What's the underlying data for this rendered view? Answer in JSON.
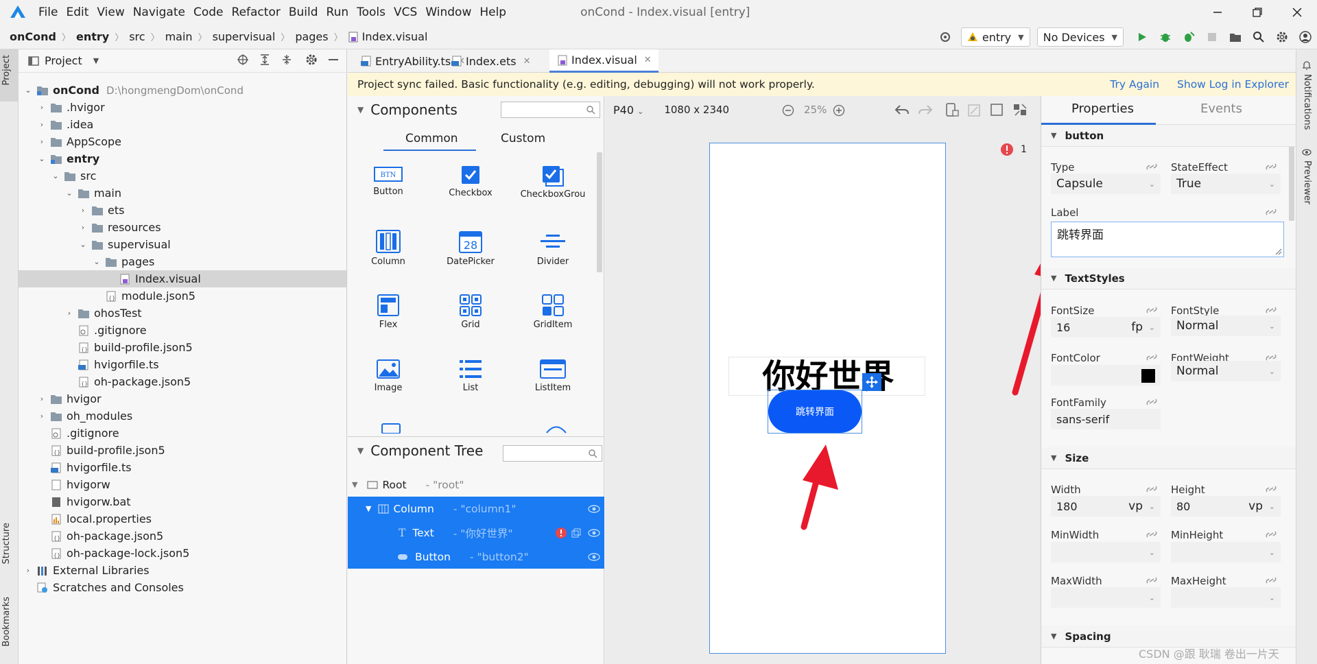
{
  "menubar": {
    "items": [
      "File",
      "Edit",
      "View",
      "Navigate",
      "Code",
      "Refactor",
      "Build",
      "Run",
      "Tools",
      "VCS",
      "Window",
      "Help"
    ],
    "window_title": "onCond - Index.visual [entry]"
  },
  "breadcrumb": [
    "onCond",
    "entry",
    "src",
    "main",
    "supervisual",
    "pages",
    "Index.visual"
  ],
  "toolbar": {
    "module_selector": "entry",
    "device_selector": "No Devices"
  },
  "project_panel": {
    "title": "Project",
    "tree": [
      {
        "label": "onCond",
        "hint": "D:\\hongmengDom\\onCond",
        "bold": true
      },
      {
        "label": ".hvigor"
      },
      {
        "label": ".idea"
      },
      {
        "label": "AppScope"
      },
      {
        "label": "entry",
        "bold": true
      },
      {
        "label": "src"
      },
      {
        "label": "main"
      },
      {
        "label": "ets"
      },
      {
        "label": "resources"
      },
      {
        "label": "supervisual"
      },
      {
        "label": "pages"
      },
      {
        "label": "Index.visual"
      },
      {
        "label": "module.json5"
      },
      {
        "label": "ohosTest"
      },
      {
        "label": ".gitignore"
      },
      {
        "label": "build-profile.json5"
      },
      {
        "label": "hvigorfile.ts"
      },
      {
        "label": "oh-package.json5"
      },
      {
        "label": "hvigor"
      },
      {
        "label": "oh_modules"
      },
      {
        "label": ".gitignore"
      },
      {
        "label": "build-profile.json5"
      },
      {
        "label": "hvigorfile.ts"
      },
      {
        "label": "hvigorw"
      },
      {
        "label": "hvigorw.bat"
      },
      {
        "label": "local.properties"
      },
      {
        "label": "oh-package.json5"
      },
      {
        "label": "oh-package-lock.json5"
      },
      {
        "label": "External Libraries"
      },
      {
        "label": "Scratches and Consoles"
      }
    ]
  },
  "side_tabs": {
    "left": [
      "Project",
      "Structure",
      "Bookmarks"
    ],
    "right": [
      "Notifications",
      "Previewer"
    ]
  },
  "editor_tabs": [
    "EntryAbility.ts",
    "Index.ets",
    "Index.visual"
  ],
  "warning": {
    "message": "Project sync failed. Basic functionality (e.g. editing, debugging) will not work properly.",
    "try_again": "Try Again",
    "show_log": "Show Log in Explorer"
  },
  "components": {
    "title": "Components",
    "tabs": [
      "Common",
      "Custom"
    ],
    "items": [
      "Button",
      "Checkbox",
      "CheckboxGrou",
      "Column",
      "DatePicker",
      "Divider",
      "Flex",
      "Grid",
      "GridItem",
      "Image",
      "List",
      "ListItem"
    ],
    "datepicker_day": "28",
    "btn_icon_text": "BTN"
  },
  "component_tree": {
    "title": "Component Tree",
    "rows": [
      {
        "label": "Root",
        "id": "- \"root\""
      },
      {
        "label": "Column",
        "id": "- \"column1\""
      },
      {
        "label": "Text",
        "id": "- \"你好世界\""
      },
      {
        "label": "Button",
        "id": "- \"button2\""
      }
    ]
  },
  "canvas": {
    "device": "P40",
    "resolution": "1080 x 2340",
    "zoom": "25%",
    "error_count": "1",
    "hello_text": "你好世界",
    "button_text": "跳转界面"
  },
  "properties": {
    "tabs": [
      "Properties",
      "Events"
    ],
    "sections": {
      "button": "button",
      "textstyles": "TextStyles",
      "size": "Size",
      "spacing": "Spacing"
    },
    "type": {
      "label": "Type",
      "value": "Capsule"
    },
    "state_effect": {
      "label": "StateEffect",
      "value": "True"
    },
    "label": {
      "label": "Label",
      "value": "跳转界面"
    },
    "font_size": {
      "label": "FontSize",
      "value": "16",
      "unit": "fp"
    },
    "font_style": {
      "label": "FontStyle",
      "value": "Normal"
    },
    "font_color": {
      "label": "FontColor",
      "value": "#000000"
    },
    "font_weight": {
      "label": "FontWeight",
      "value": "Normal"
    },
    "font_family": {
      "label": "FontFamily",
      "value": "sans-serif"
    },
    "width": {
      "label": "Width",
      "value": "180",
      "unit": "vp"
    },
    "height": {
      "label": "Height",
      "value": "80",
      "unit": "vp"
    },
    "min_width": {
      "label": "MinWidth"
    },
    "min_height": {
      "label": "MinHeight"
    },
    "max_width": {
      "label": "MaxWidth"
    },
    "max_height": {
      "label": "MaxHeight"
    }
  },
  "watermark": "CSDN @跟 耿瑞 卷出一片天",
  "colors": {
    "accent": "#1a7bf2",
    "canvas_button": "#0a59f7",
    "annotation": "#e8192c"
  }
}
